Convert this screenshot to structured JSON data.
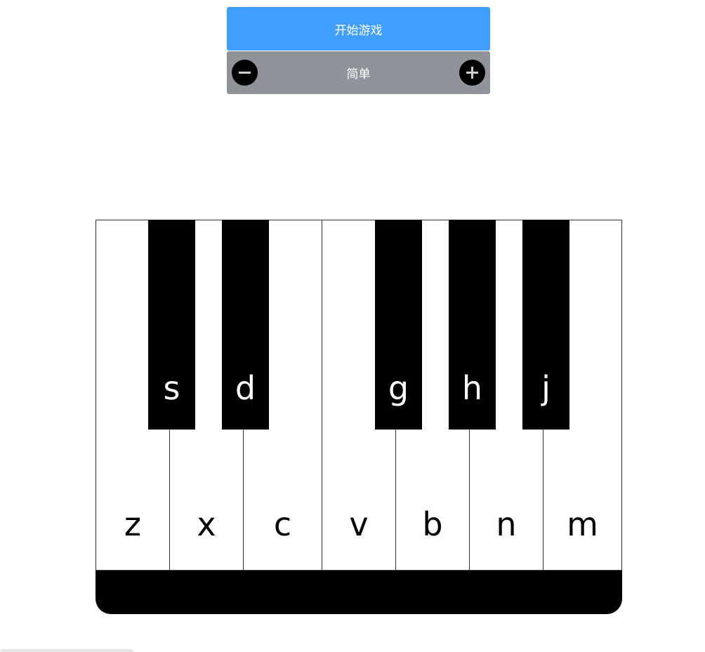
{
  "controls": {
    "start_label": "开始游戏",
    "difficulty_label": "简单",
    "decrease_icon": "minus-icon",
    "increase_icon": "plus-icon"
  },
  "colors": {
    "start_button": "#409eff",
    "difficulty_bar": "#909399",
    "white_key": "#ffffff",
    "black_key": "#000000"
  },
  "piano": {
    "white_keys": [
      {
        "label": "z"
      },
      {
        "label": "x"
      },
      {
        "label": "c"
      },
      {
        "label": "v"
      },
      {
        "label": "b"
      },
      {
        "label": "n"
      },
      {
        "label": "m"
      }
    ],
    "black_keys": [
      {
        "label": "s"
      },
      {
        "label": "d"
      },
      {
        "label": "g"
      },
      {
        "label": "h"
      },
      {
        "label": "j"
      }
    ]
  }
}
